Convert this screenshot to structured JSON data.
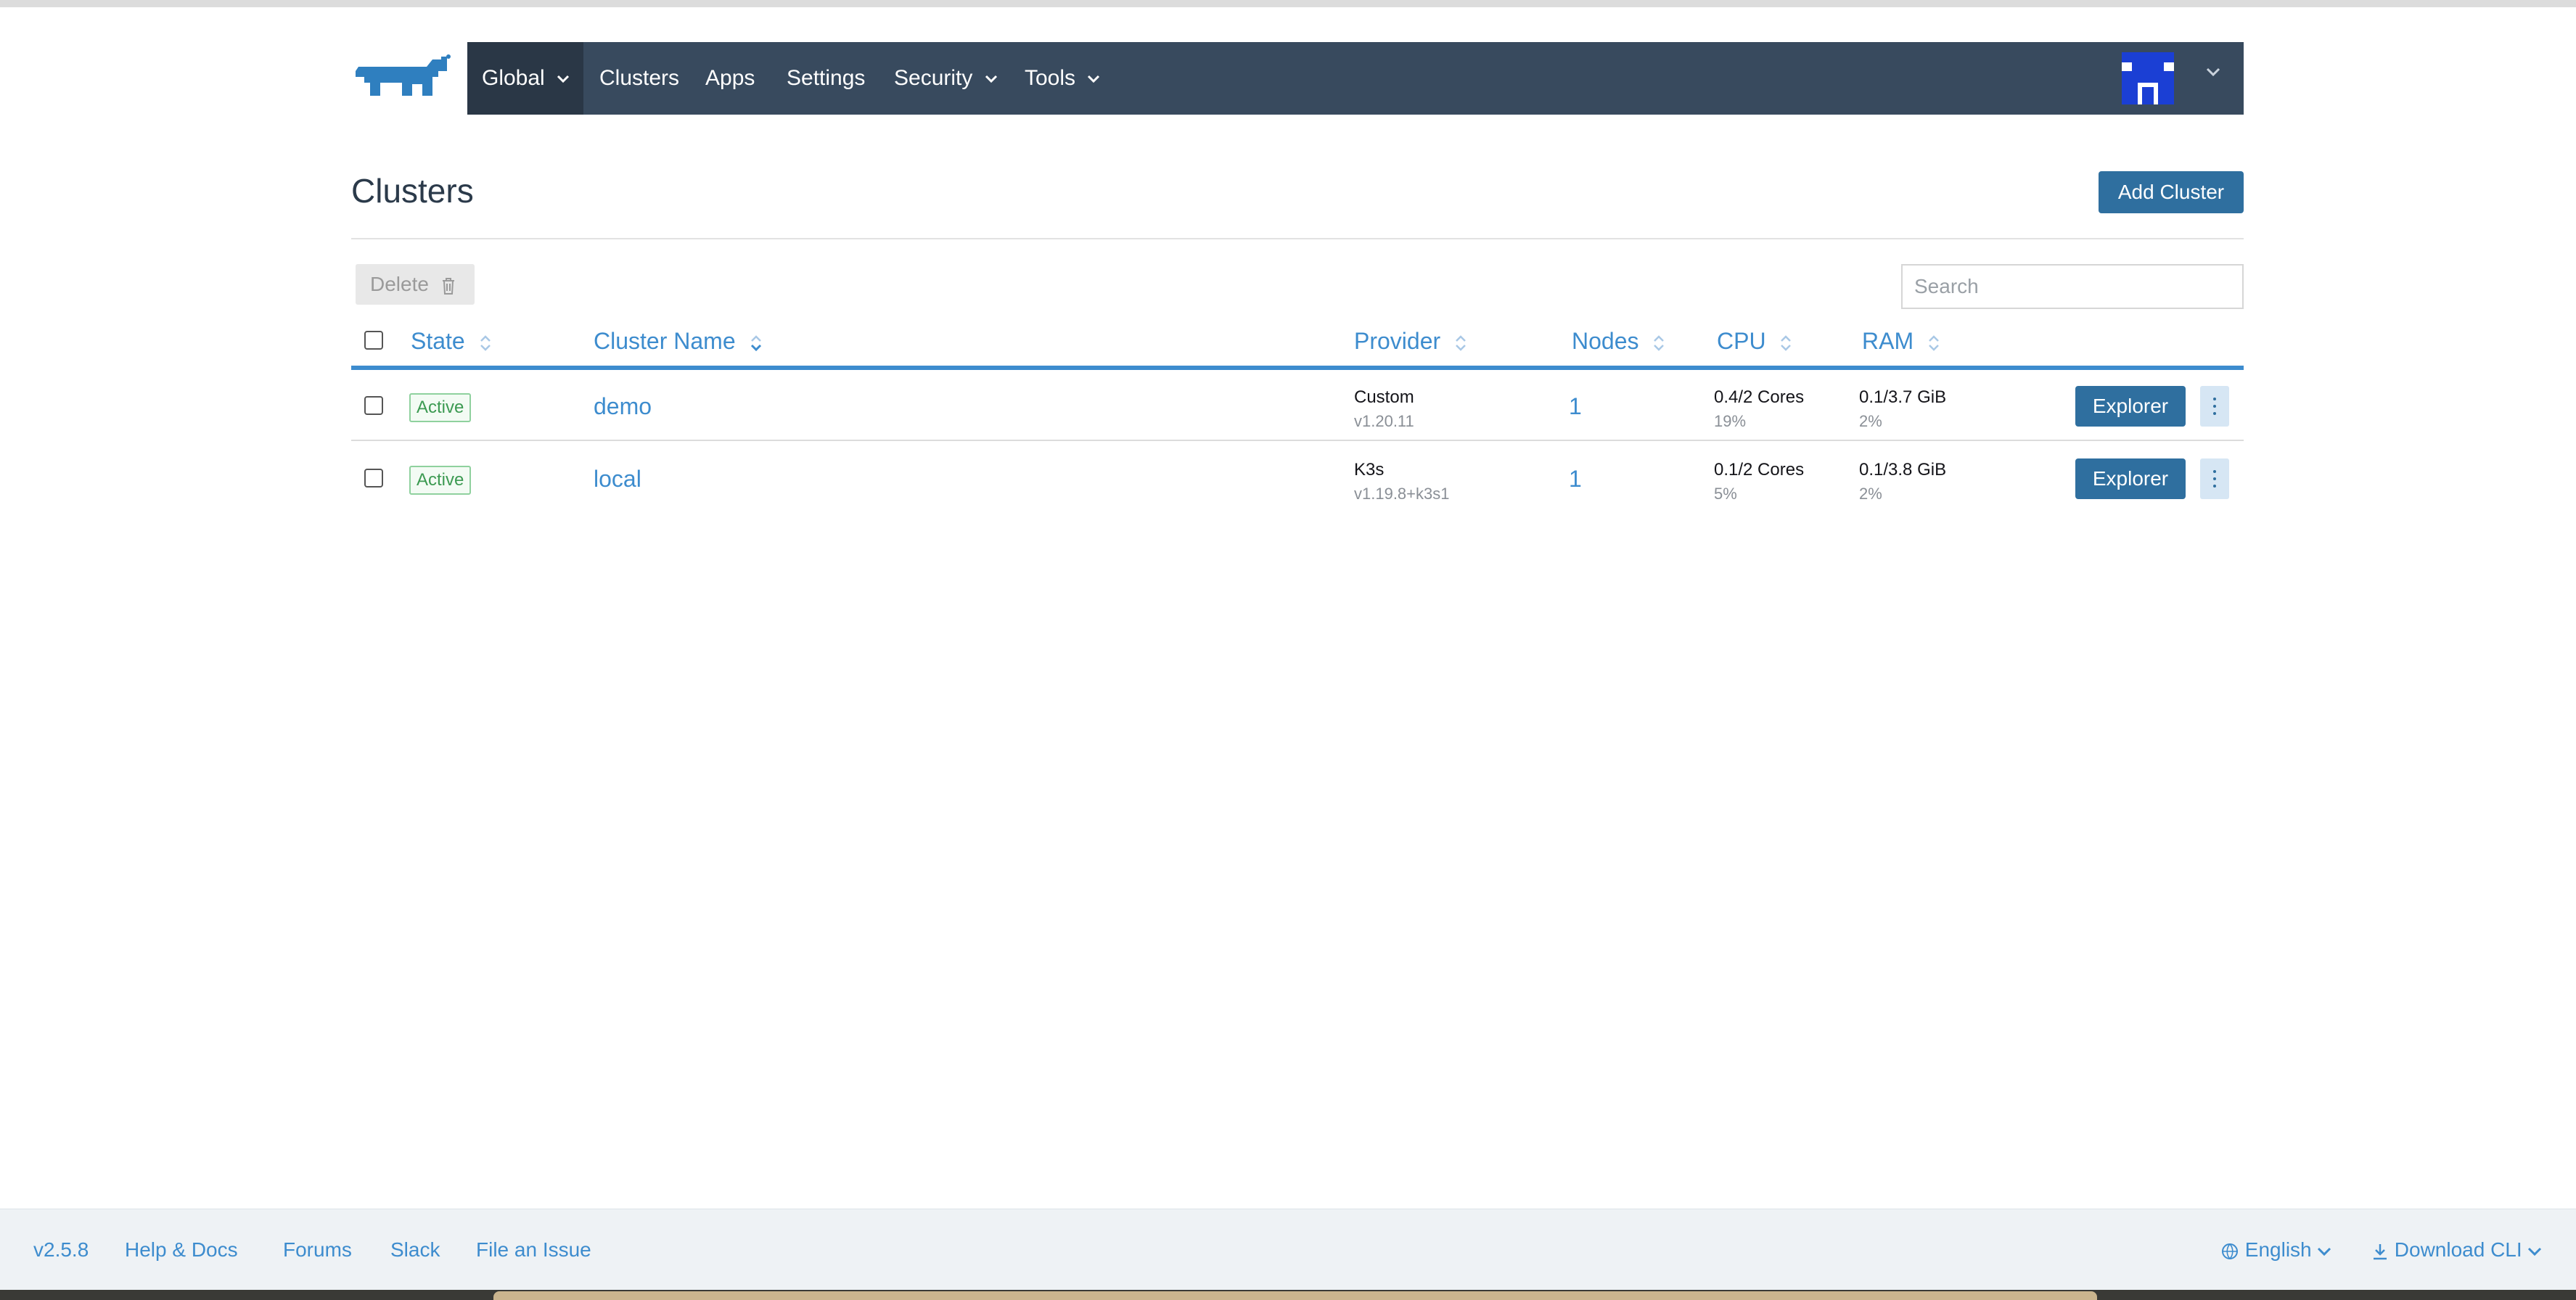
{
  "nav": {
    "global": "Global",
    "clusters": "Clusters",
    "apps": "Apps",
    "settings": "Settings",
    "security": "Security",
    "tools": "Tools"
  },
  "page": {
    "title": "Clusters",
    "add_cluster": "Add Cluster",
    "delete": "Delete",
    "search_placeholder": "Search"
  },
  "table": {
    "headers": {
      "state": "State",
      "name": "Cluster Name",
      "provider": "Provider",
      "nodes": "Nodes",
      "cpu": "CPU",
      "ram": "RAM"
    },
    "rows": [
      {
        "state": "Active",
        "name": "demo",
        "provider": "Custom",
        "provider_version": "v1.20.11",
        "nodes": "1",
        "cpu": "0.4/2 Cores",
        "cpu_pct": "19%",
        "ram": "0.1/3.7 GiB",
        "ram_pct": "2%",
        "action": "Explorer"
      },
      {
        "state": "Active",
        "name": "local",
        "provider": "K3s",
        "provider_version": "v1.19.8+k3s1",
        "nodes": "1",
        "cpu": "0.1/2 Cores",
        "cpu_pct": "5%",
        "ram": "0.1/3.8 GiB",
        "ram_pct": "2%",
        "action": "Explorer"
      }
    ]
  },
  "footer": {
    "version": "v2.5.8",
    "help": "Help & Docs",
    "forums": "Forums",
    "slack": "Slack",
    "issue": "File an Issue",
    "language": "English",
    "download": "Download CLI"
  },
  "colors": {
    "navbar": "#384a5e",
    "nav_active": "#2a3746",
    "link": "#3d8cce",
    "primary_button": "#2f6f9f",
    "active_badge": "#3c9a52"
  },
  "icons": [
    "rancher-logo",
    "chevron-down-icon",
    "sort-icon",
    "trash-icon",
    "avatar",
    "kebab-icon",
    "globe-icon",
    "download-icon"
  ]
}
